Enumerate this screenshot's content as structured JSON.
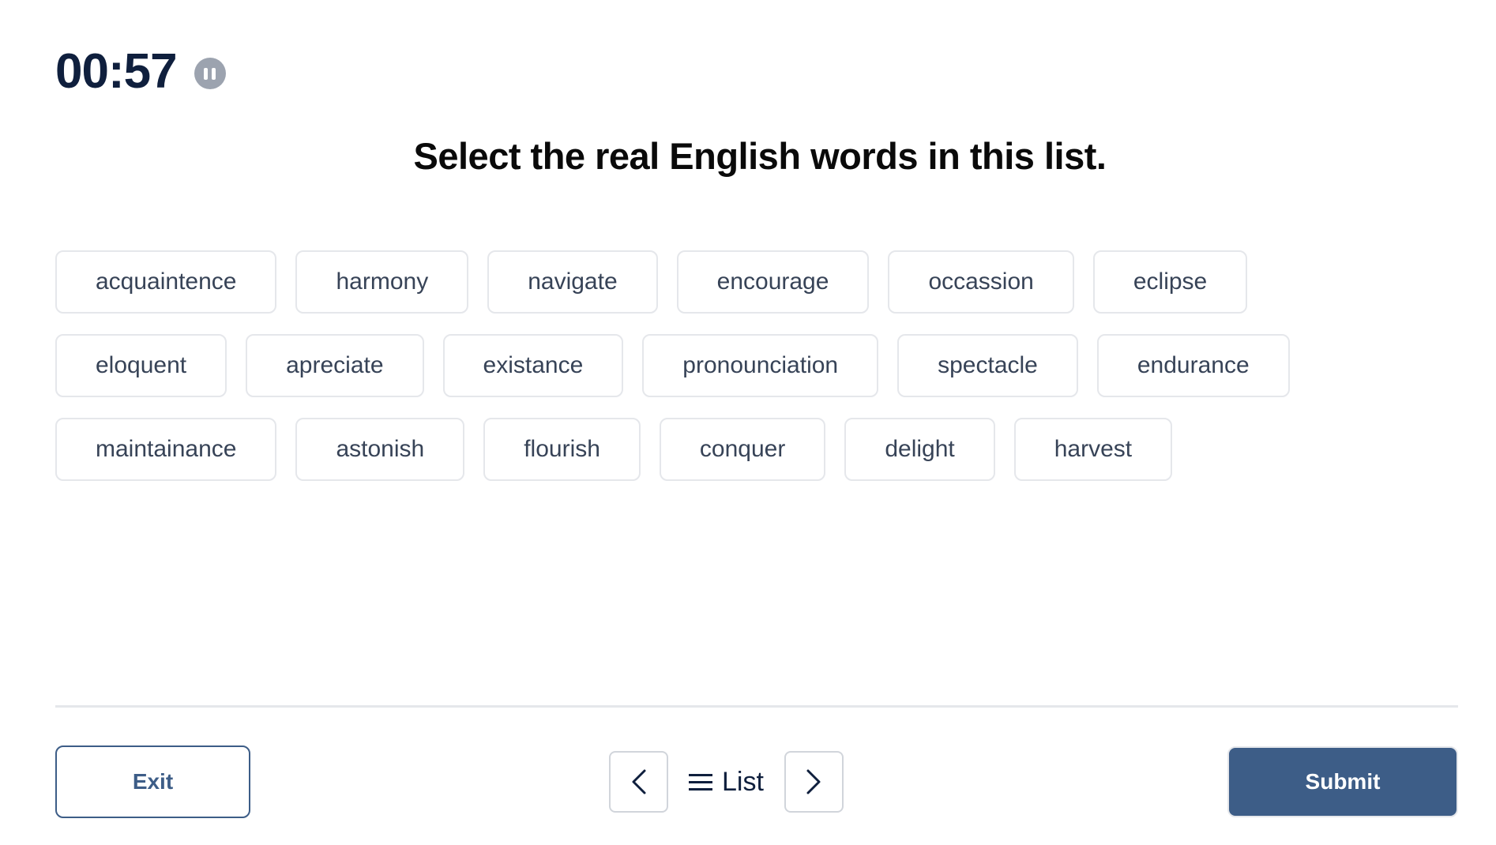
{
  "timer": {
    "value": "00:57",
    "pause_icon": "pause-icon"
  },
  "question": {
    "prompt": "Select the real English words in this list."
  },
  "words": {
    "rows": [
      [
        "acquaintence",
        "harmony",
        "navigate",
        "encourage",
        "occassion",
        "eclipse"
      ],
      [
        "eloquent",
        "apreciate",
        "existance",
        "pronounciation",
        "spectacle",
        "endurance"
      ],
      [
        "maintainance",
        "astonish",
        "flourish",
        "conquer",
        "delight",
        "harvest"
      ]
    ]
  },
  "footer": {
    "exit_label": "Exit",
    "submit_label": "Submit",
    "list_label": "List",
    "prev_icon": "chevron-left-icon",
    "next_icon": "chevron-right-icon",
    "list_icon": "hamburger-icon"
  },
  "colors": {
    "accent": "#3d5d87",
    "timer_text": "#0f1f3d",
    "chip_text": "#374357",
    "chip_border": "#e5e7eb",
    "pause_bg": "#9ca3af"
  }
}
